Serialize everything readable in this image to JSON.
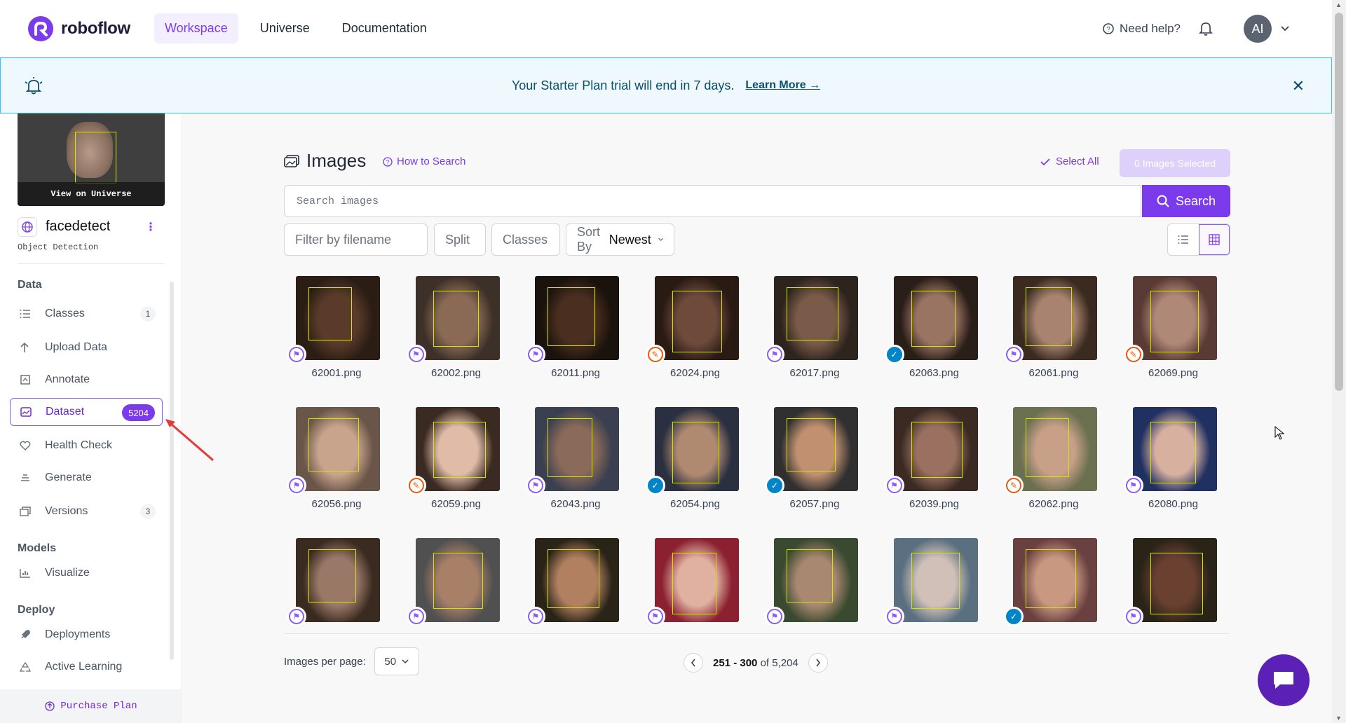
{
  "nav": {
    "brand": "roboflow",
    "links": [
      {
        "label": "Workspace",
        "active": true
      },
      {
        "label": "Universe",
        "active": false
      },
      {
        "label": "Documentation",
        "active": false
      }
    ],
    "help_label": "Need help?",
    "avatar_initials": "AI"
  },
  "banner": {
    "text": "Your Starter Plan trial will end in 7 days.",
    "link": "Learn More",
    "close": "✕"
  },
  "sidebar": {
    "preview_button": "View on Universe",
    "project_name": "facedetect",
    "project_type": "Object Detection",
    "sections": {
      "data": "Data",
      "models": "Models",
      "deploy": "Deploy"
    },
    "items": [
      {
        "label": "Classes",
        "count": "1",
        "icon": "list-icon"
      },
      {
        "label": "Upload Data",
        "icon": "upload-icon"
      },
      {
        "label": "Annotate",
        "icon": "annotate-icon"
      },
      {
        "label": "Dataset",
        "count": "5204",
        "icon": "images-icon",
        "active": true
      },
      {
        "label": "Health Check",
        "icon": "heart-icon"
      },
      {
        "label": "Generate",
        "icon": "generate-icon"
      },
      {
        "label": "Versions",
        "count": "3",
        "icon": "versions-icon"
      },
      {
        "label": "Visualize",
        "icon": "chart-icon"
      },
      {
        "label": "Deployments",
        "icon": "rocket-icon"
      },
      {
        "label": "Active Learning",
        "icon": "recycle-icon"
      }
    ],
    "purchase_label": "Purchase Plan"
  },
  "main": {
    "title": "Images",
    "how_to_search": "How to Search",
    "select_all": "Select All",
    "selected_label": "0 Images Selected",
    "search_placeholder": "Search images",
    "search_button": "Search",
    "filter_placeholder": "Filter by filename",
    "split_label": "Split",
    "classes_label": "Classes",
    "sort_label": "Sort By",
    "sort_value": "Newest"
  },
  "images": [
    {
      "name": "62001.png",
      "status": "run"
    },
    {
      "name": "62002.png",
      "status": "run"
    },
    {
      "name": "62011.png",
      "status": "run"
    },
    {
      "name": "62024.png",
      "status": "edit"
    },
    {
      "name": "62017.png",
      "status": "run"
    },
    {
      "name": "62063.png",
      "status": "ok"
    },
    {
      "name": "62061.png",
      "status": "run"
    },
    {
      "name": "62069.png",
      "status": "edit"
    },
    {
      "name": "62056.png",
      "status": "run"
    },
    {
      "name": "62059.png",
      "status": "edit"
    },
    {
      "name": "62043.png",
      "status": "run"
    },
    {
      "name": "62054.png",
      "status": "ok"
    },
    {
      "name": "62057.png",
      "status": "ok"
    },
    {
      "name": "62039.png",
      "status": "run"
    },
    {
      "name": "62062.png",
      "status": "edit"
    },
    {
      "name": "62080.png",
      "status": "run"
    },
    {
      "name": "",
      "status": "run"
    },
    {
      "name": "",
      "status": "run"
    },
    {
      "name": "",
      "status": "run"
    },
    {
      "name": "",
      "status": "run"
    },
    {
      "name": "",
      "status": "run"
    },
    {
      "name": "",
      "status": "run"
    },
    {
      "name": "",
      "status": "ok"
    },
    {
      "name": "",
      "status": "run"
    }
  ],
  "pagination": {
    "per_page_label": "Images per page:",
    "per_page_value": "50",
    "range": "251 - 300",
    "total": "of 5,204"
  },
  "colors": {
    "accent": "#7c3aed",
    "banner_border": "#38bdf8",
    "bbox": "#d4e600"
  }
}
